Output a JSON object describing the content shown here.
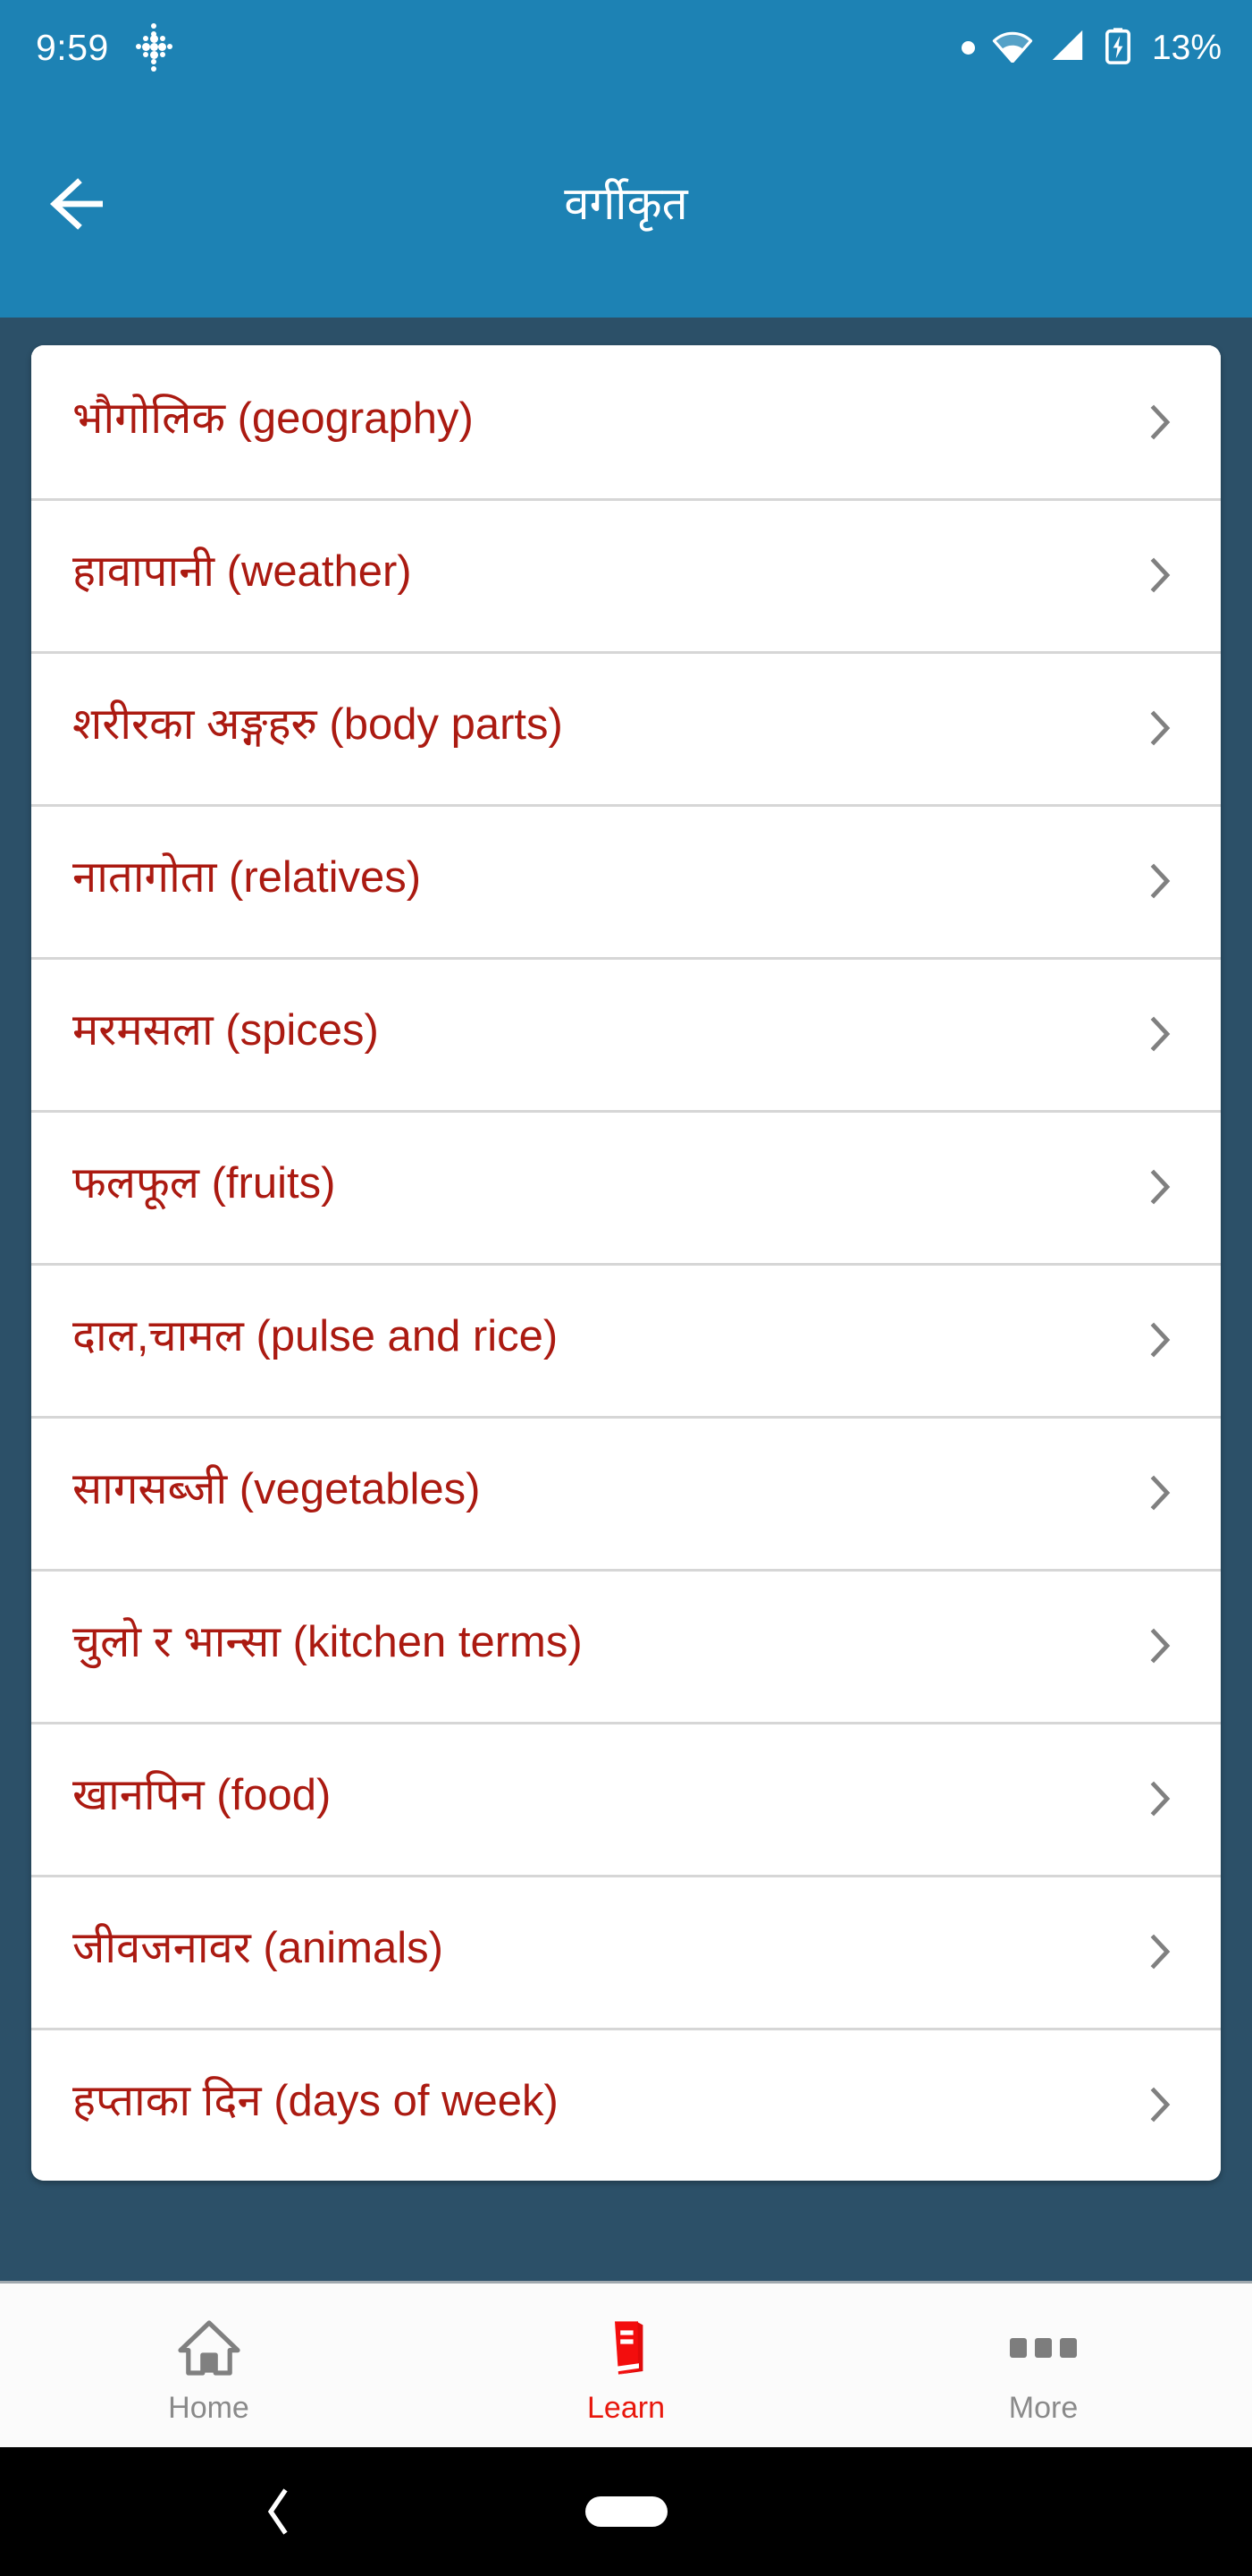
{
  "status_bar": {
    "time": "9:59",
    "notification_icon": "dotted-diamond-icon",
    "indicator_dot": "status-dot-icon",
    "wifi_icon": "wifi-icon",
    "signal_icon": "cellular-signal-icon",
    "battery_icon": "battery-charging-icon",
    "battery_percent": "13%",
    "background_color": "#1d82b4"
  },
  "app_bar": {
    "back_icon": "arrow-left-icon",
    "title": "वर्गीकृत",
    "background_color": "#1d82b4",
    "text_color": "#ffffff"
  },
  "page": {
    "background_color": "#2c5068",
    "card_background": "#ffffff",
    "item_text_color": "#ab1a11",
    "chevron_color": "#808080"
  },
  "category_list": {
    "chevron_icon": "chevron-right-icon",
    "items": [
      {
        "label": "भौगोलिक (geography)"
      },
      {
        "label": "हावापानी (weather)"
      },
      {
        "label": "शरीरका अङ्गहरु (body parts)"
      },
      {
        "label": "नातागोता (relatives)"
      },
      {
        "label": "मरमसला (spices)"
      },
      {
        "label": "फलफूल (fruits)"
      },
      {
        "label": "दाल,चामल (pulse and rice)"
      },
      {
        "label": "सागसब्जी (vegetables)"
      },
      {
        "label": "चुलो र भान्सा (kitchen terms)"
      },
      {
        "label": "खानपिन (food)"
      },
      {
        "label": "जीवजनावर (animals)"
      },
      {
        "label": "हप्ताका दिन (days of week)"
      }
    ]
  },
  "tab_bar": {
    "active_color": "#e8170c",
    "inactive_color": "#8a8a8a",
    "tabs": [
      {
        "label": "Home",
        "icon": "home-icon",
        "active": false
      },
      {
        "label": "Learn",
        "icon": "book-icon",
        "active": true
      },
      {
        "label": "More",
        "icon": "more-dots-icon",
        "active": false
      }
    ]
  },
  "system_nav": {
    "back_icon": "system-back-icon",
    "home_pill_icon": "home-pill-icon",
    "background_color": "#000000"
  }
}
